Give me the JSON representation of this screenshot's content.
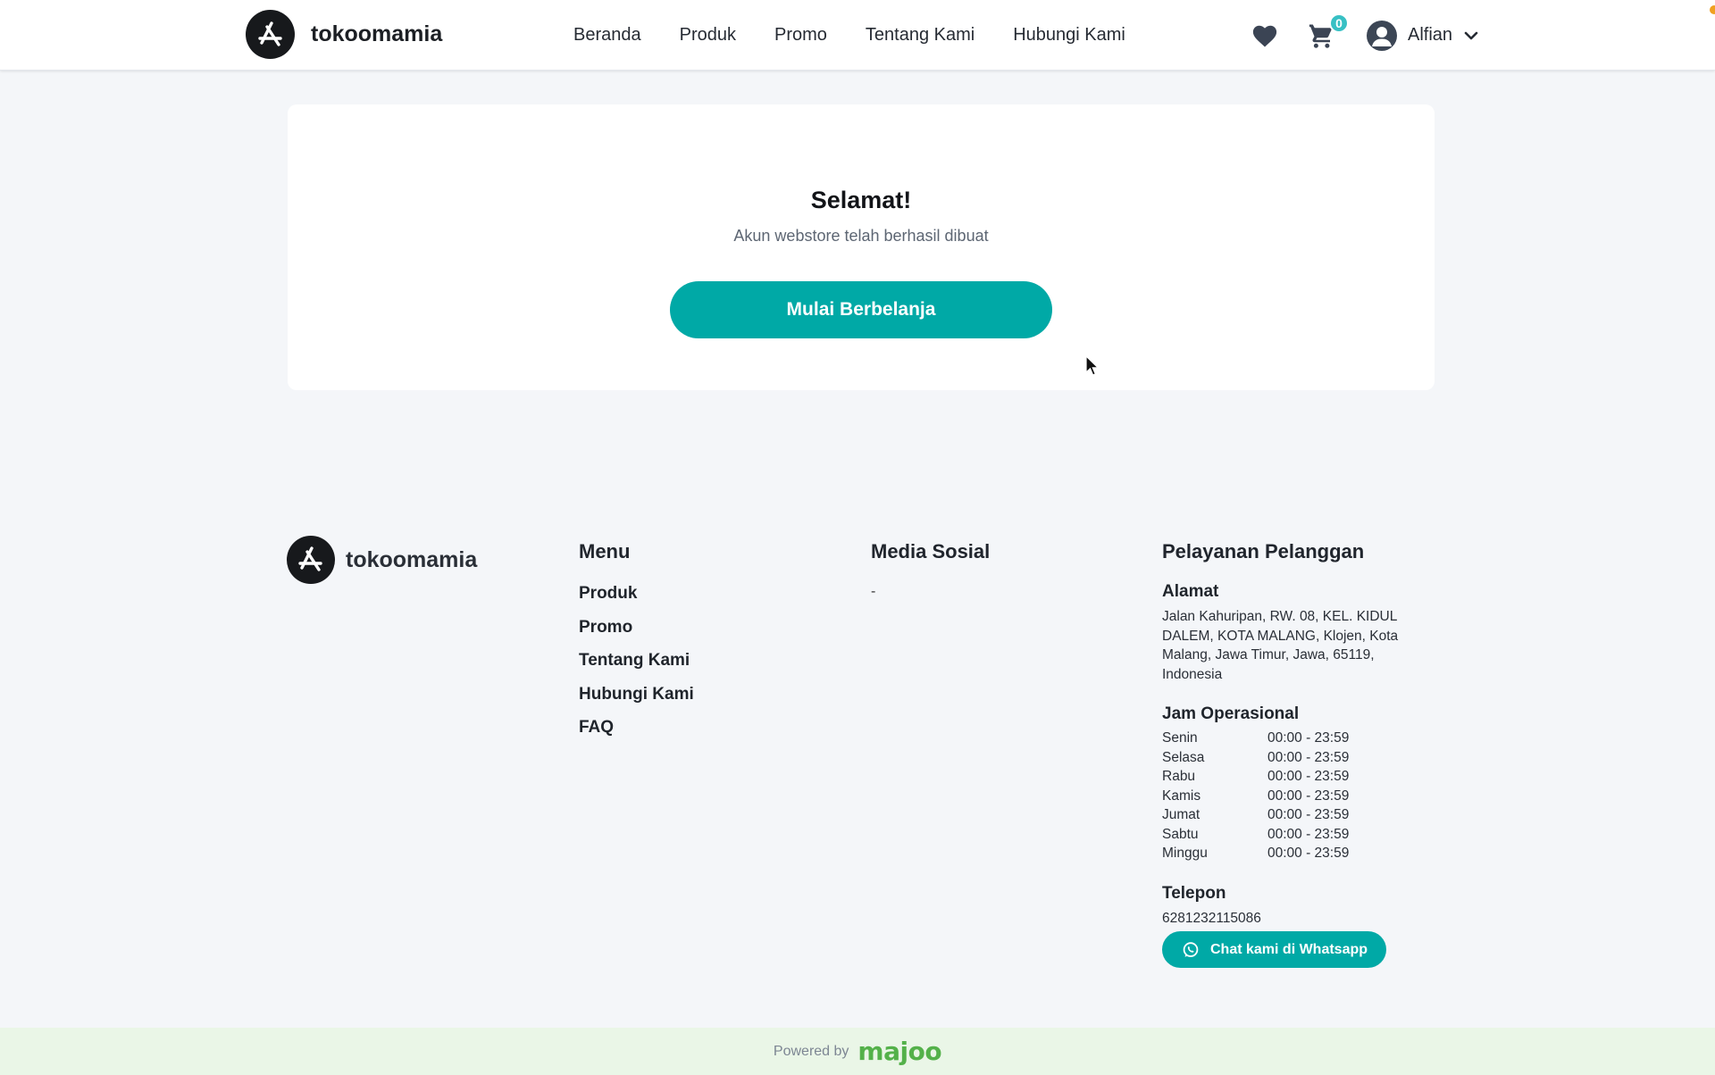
{
  "brand": {
    "name": "tokoomamia"
  },
  "nav": {
    "items": [
      {
        "label": "Beranda"
      },
      {
        "label": "Produk"
      },
      {
        "label": "Promo"
      },
      {
        "label": "Tentang Kami"
      },
      {
        "label": "Hubungi Kami"
      }
    ]
  },
  "header": {
    "cart_count": "0",
    "user_name": "Alfian",
    "icons": {
      "wishlist": "heart-icon",
      "cart": "cart-icon",
      "avatar": "user-avatar-icon",
      "dropdown": "chevron-down-icon"
    }
  },
  "success": {
    "title": "Selamat!",
    "subtitle": "Akun webstore telah berhasil dibuat",
    "button_label": "Mulai Berbelanja"
  },
  "footer": {
    "menu": {
      "title": "Menu",
      "items": [
        {
          "label": "Produk"
        },
        {
          "label": "Promo"
        },
        {
          "label": "Tentang Kami"
        },
        {
          "label": "Hubungi Kami"
        },
        {
          "label": "FAQ"
        }
      ]
    },
    "social": {
      "title": "Media Sosial",
      "value": "-"
    },
    "service": {
      "title": "Pelayanan Pelanggan",
      "address_label": "Alamat",
      "address": "Jalan Kahuripan, RW. 08, KEL. KIDUL DALEM, KOTA MALANG, Klojen, Kota Malang, Jawa Timur, Jawa, 65119, Indonesia",
      "hours_label": "Jam Operasional",
      "hours": [
        {
          "day": "Senin",
          "time": "00:00 - 23:59"
        },
        {
          "day": "Selasa",
          "time": "00:00 - 23:59"
        },
        {
          "day": "Rabu",
          "time": "00:00 - 23:59"
        },
        {
          "day": "Kamis",
          "time": "00:00 - 23:59"
        },
        {
          "day": "Jumat",
          "time": "00:00 - 23:59"
        },
        {
          "day": "Sabtu",
          "time": "00:00 - 23:59"
        },
        {
          "day": "Minggu",
          "time": "00:00 - 23:59"
        }
      ],
      "phone_label": "Telepon",
      "phone": "6281232115086",
      "whatsapp_label": "Chat kami di Whatsapp"
    },
    "powered_by": "Powered by",
    "powered_logo": "majoo"
  },
  "colors": {
    "accent": "#00a9a6",
    "badge": "#38c0c4",
    "powered_bg": "#eaf6e7"
  }
}
